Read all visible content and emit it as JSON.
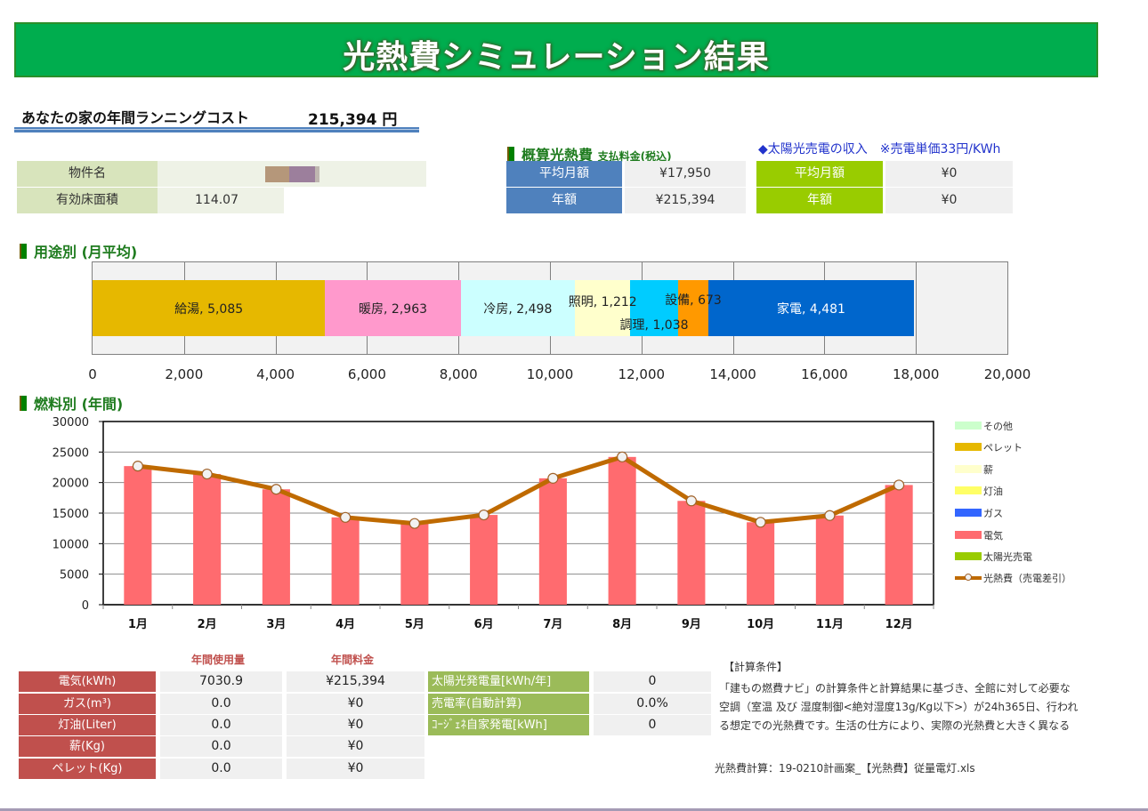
{
  "banner": {
    "title": "光熱費シミュレーション結果"
  },
  "running_cost": {
    "label": "あなたの家の年間ランニングコスト",
    "value": "215,394 円"
  },
  "property": {
    "rows": [
      {
        "label": "物件名",
        "value": ""
      },
      {
        "label": "有効床面積",
        "value": "114.07"
      }
    ],
    "redaction_colors": [
      "#b5977a",
      "#9c7f9c",
      "#bfb7b0"
    ]
  },
  "estimate": {
    "title": "概算光熱費",
    "subtitle": "支払料金(税込)",
    "rows": [
      {
        "label": "平均月額",
        "value": "¥17,950"
      },
      {
        "label": "年額",
        "value": "¥215,394"
      }
    ]
  },
  "solar_income": {
    "title": "◆太陽光売電の収入　※売電単価33円/KWh",
    "rows": [
      {
        "label": "平均月額",
        "value": "¥0"
      },
      {
        "label": "年額",
        "value": "¥0"
      }
    ]
  },
  "usage_section": {
    "title": "用途別 (月平均)"
  },
  "fuel_section": {
    "title": "燃料別 (年間)"
  },
  "chart_data": [
    {
      "type": "bar",
      "orientation": "horizontal-stacked",
      "title": "用途別 (月平均)",
      "xlim": [
        0,
        20000
      ],
      "xticks": [
        "0",
        "2,000",
        "4,000",
        "6,000",
        "8,000",
        "10,000",
        "12,000",
        "14,000",
        "16,000",
        "18,000",
        "20,000"
      ],
      "xtick_values": [
        0,
        2000,
        4000,
        6000,
        8000,
        10000,
        12000,
        14000,
        16000,
        18000,
        20000
      ],
      "grid": true,
      "series": [
        {
          "name": "給湯",
          "value": 5085,
          "label": "給湯, 5,085",
          "color": "#e6b800"
        },
        {
          "name": "暖房",
          "value": 2963,
          "label": "暖房, 2,963",
          "color": "#ff99cc"
        },
        {
          "name": "冷房",
          "value": 2498,
          "label": "冷房, 2,498",
          "color": "#ccffff"
        },
        {
          "name": "照明",
          "value": 1212,
          "label": "照明, 1,212",
          "color": "#ffffcc"
        },
        {
          "name": "調理",
          "value": 1038,
          "label": "調理, 1,038",
          "color": "#00ccff"
        },
        {
          "name": "設備",
          "value": 673,
          "label": "設備, 673",
          "color": "#ff9900"
        },
        {
          "name": "家電",
          "value": 4481,
          "label": "家電, 4,481",
          "color": "#0066cc"
        }
      ]
    },
    {
      "type": "bar",
      "title": "燃料別 (年間)",
      "categories": [
        "1月",
        "2月",
        "3月",
        "4月",
        "5月",
        "6月",
        "7月",
        "8月",
        "9月",
        "10月",
        "11月",
        "12月"
      ],
      "ylim": [
        0,
        30000
      ],
      "yticks": [
        "0",
        "5000",
        "10000",
        "15000",
        "20000",
        "25000",
        "30000"
      ],
      "ytick_values": [
        0,
        5000,
        10000,
        15000,
        20000,
        25000,
        30000
      ],
      "grid": true,
      "legend_position": "right",
      "series": [
        {
          "name": "その他",
          "kind": "bar",
          "color": "#ccffcc",
          "values": [
            0,
            0,
            0,
            0,
            0,
            0,
            0,
            0,
            0,
            0,
            0,
            0
          ]
        },
        {
          "name": "ペレット",
          "kind": "bar",
          "color": "#e6b800",
          "values": [
            0,
            0,
            0,
            0,
            0,
            0,
            0,
            0,
            0,
            0,
            0,
            0
          ]
        },
        {
          "name": "薪",
          "kind": "bar",
          "color": "#ffffcc",
          "values": [
            0,
            0,
            0,
            0,
            0,
            0,
            0,
            0,
            0,
            0,
            0,
            0
          ]
        },
        {
          "name": "灯油",
          "kind": "bar",
          "color": "#ffff66",
          "values": [
            0,
            0,
            0,
            0,
            0,
            0,
            0,
            0,
            0,
            0,
            0,
            0
          ]
        },
        {
          "name": "ガス",
          "kind": "bar",
          "color": "#3366ff",
          "values": [
            0,
            0,
            0,
            0,
            0,
            0,
            0,
            0,
            0,
            0,
            0,
            0
          ]
        },
        {
          "name": "電気",
          "kind": "bar",
          "color": "#ff6b6f",
          "values": [
            22700,
            21400,
            18900,
            14300,
            13300,
            14700,
            20700,
            24200,
            17000,
            13500,
            14600,
            19600
          ]
        },
        {
          "name": "太陽光売電",
          "kind": "bar",
          "color": "#99cc00",
          "values": [
            0,
            0,
            0,
            0,
            0,
            0,
            0,
            0,
            0,
            0,
            0,
            0
          ]
        },
        {
          "name": "光熱費（売電差引）",
          "kind": "line",
          "color": "#bf6a00",
          "values": [
            22700,
            21400,
            18900,
            14300,
            13300,
            14700,
            20700,
            24200,
            17000,
            13500,
            14600,
            19600
          ]
        }
      ]
    }
  ],
  "fuel_table": {
    "headers": {
      "usage": "年間使用量",
      "fee": "年間料金"
    },
    "rows": [
      {
        "label": "電気(kWh)",
        "usage": "7030.9",
        "fee": "¥215,394"
      },
      {
        "label": "ガス(m³)",
        "usage": "0.0",
        "fee": "¥0"
      },
      {
        "label": "灯油(Liter)",
        "usage": "0.0",
        "fee": "¥0"
      },
      {
        "label": "薪(Kg)",
        "usage": "0.0",
        "fee": "¥0"
      },
      {
        "label": "ペレット(Kg)",
        "usage": "0.0",
        "fee": "¥0"
      }
    ]
  },
  "solar_table": {
    "rows": [
      {
        "label": "太陽光発電量[kWh/年]",
        "value": "0"
      },
      {
        "label": "売電率(自動計算)",
        "value": "0.0%"
      },
      {
        "label": "ｺｰｼﾞｪﾈ自家発電[kWh]",
        "value": "0"
      }
    ]
  },
  "notes": {
    "title": "【計算条件】",
    "lines": [
      "「建もの燃費ナビ」の計算条件と計算結果に基づき、全館に対して必要な",
      "空調（室温 及び 湿度制御<絶対湿度13g/Kg以下>）が24h365日、行われ",
      "る想定での光熱費です。生活の仕方により、実際の光熱費と大きく異なる"
    ],
    "file": "光熱費計算：19-0210計画案_【光熱費】従量電灯.xls"
  }
}
